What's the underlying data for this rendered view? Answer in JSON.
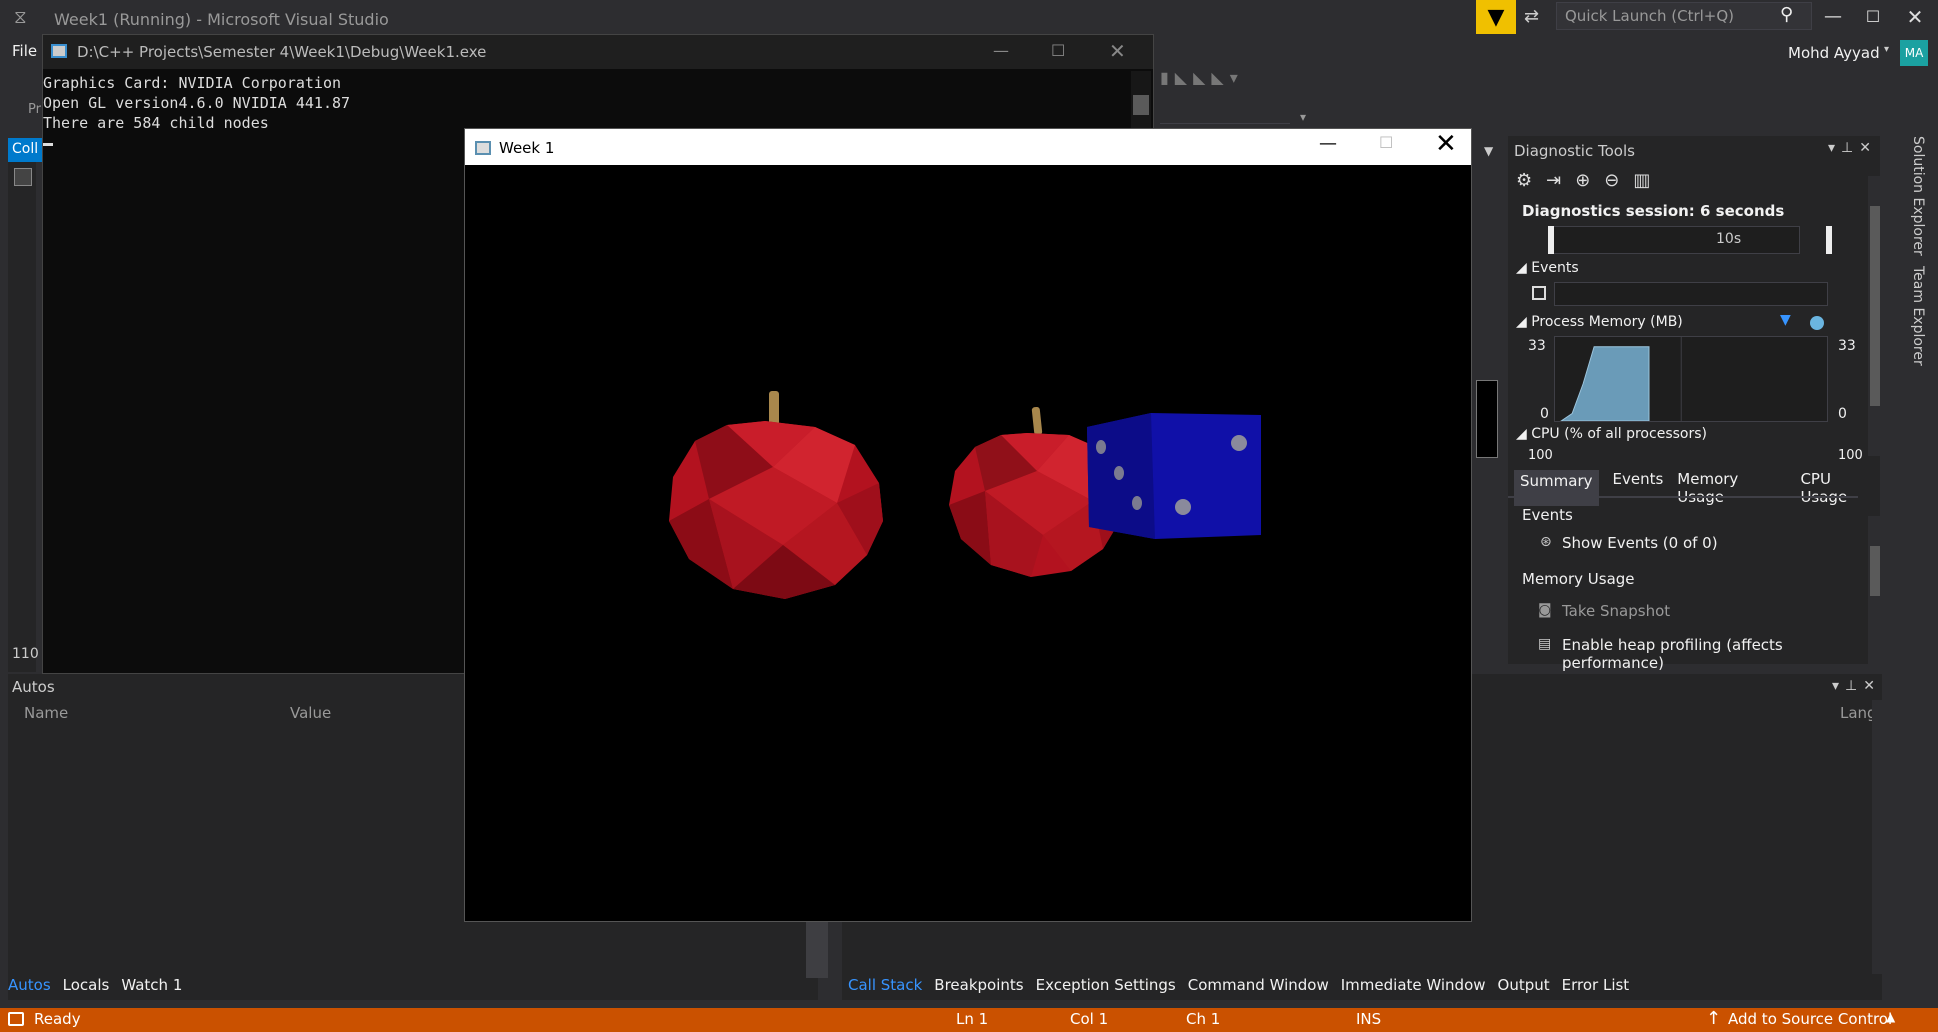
{
  "app": {
    "title": "Week1 (Running) - Microsoft Visual Studio",
    "quick_launch_placeholder": "Quick Launch (Ctrl+Q)",
    "user_name": "Mohd Ayyad",
    "user_initials": "MA",
    "accent_color": "#007acc",
    "status_color": "#ca5100",
    "filter_color": "#f0c000"
  },
  "menu": {
    "file": "File"
  },
  "left": {
    "pr_fragment": "Pr",
    "tab_fragment": "Coll",
    "line_number": "110"
  },
  "console": {
    "path": "D:\\C++ Projects\\Semester 4\\Week1\\Debug\\Week1.exe",
    "lines": [
      "Graphics Card: NVIDIA Corporation",
      "Open GL version4.6.0 NVIDIA 441.87",
      "There are 584 child nodes"
    ]
  },
  "game": {
    "title": "Week 1",
    "scene": {
      "objects": [
        "red apple",
        "red apple",
        "blue die"
      ],
      "apple_color": "#b3121f",
      "die_color": "#1010a8"
    }
  },
  "autos": {
    "title": "Autos",
    "col_name": "Name",
    "col_value": "Value",
    "tabs": [
      "Autos",
      "Locals",
      "Watch 1"
    ]
  },
  "callstack": {
    "col_lang": "Lang",
    "tabs": [
      "Call Stack",
      "Breakpoints",
      "Exception Settings",
      "Command Window",
      "Immediate Window",
      "Output",
      "Error List"
    ]
  },
  "diagnostics": {
    "title": "Diagnostic Tools",
    "session": "Diagnostics session: 6 seconds",
    "timeline_label": "10s",
    "events_header": "Events",
    "process_memory_header": "Process Memory (MB)",
    "mem_max": "33",
    "mem_min": "0",
    "memory_trace": [
      0,
      0.1,
      0.5,
      1,
      1,
      1,
      1,
      1,
      1
    ],
    "cpu_header": "CPU (% of all processors)",
    "cpu_max": "100",
    "tabs": [
      "Summary",
      "Events",
      "Memory Usage",
      "CPU Usage"
    ],
    "summary_events": "Events",
    "show_events": "Show Events (0 of 0)",
    "memory_usage": "Memory Usage",
    "take_snapshot": "Take Snapshot",
    "heap_profiling": "Enable heap profiling (affects performance)"
  },
  "right_tabs": {
    "solution": "Solution Explorer",
    "team": "Team Explorer"
  },
  "status": {
    "ready": "Ready",
    "ln": "Ln 1",
    "col": "Col 1",
    "ch": "Ch 1",
    "ins": "INS",
    "source_control": "Add to Source Control"
  }
}
